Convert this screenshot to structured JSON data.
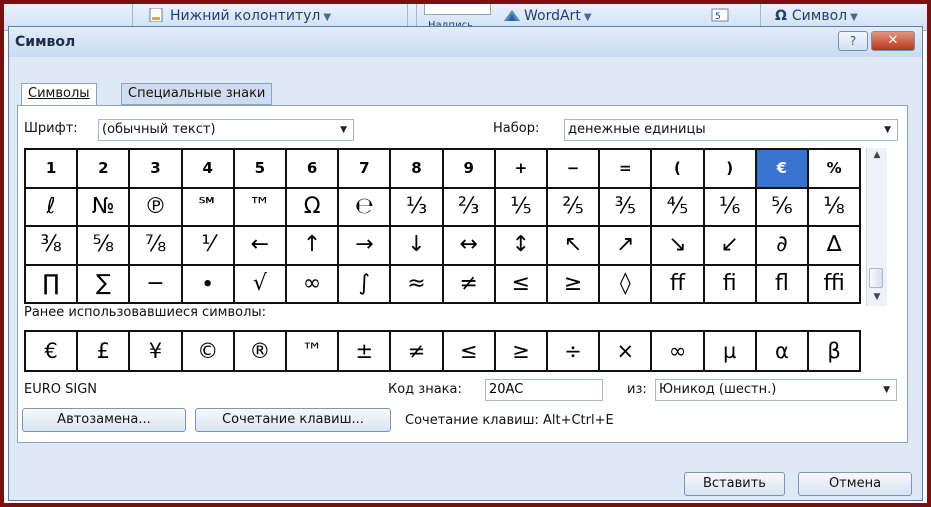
{
  "ribbon": {
    "footer_label": "Нижний колонтитул",
    "wordart_label": "WordArt",
    "symbol_label": "Символ",
    "partial_label": "Надпись",
    "omega_glyph": "Ω"
  },
  "dialog": {
    "title": "Символ",
    "help_glyph": "?",
    "close_glyph": "✕"
  },
  "tabs": [
    {
      "label": "Символы",
      "active": true
    },
    {
      "label": "Специальные знаки",
      "active": false
    }
  ],
  "font": {
    "label": "Шрифт:",
    "value": "(обычный текст)"
  },
  "subset": {
    "label": "Набор:",
    "value": "денежные единицы"
  },
  "symbols": [
    [
      "1",
      "2",
      "3",
      "4",
      "5",
      "6",
      "7",
      "8",
      "9",
      "+",
      "−",
      "=",
      "(",
      ")",
      "€",
      "%"
    ],
    [
      "ℓ",
      "№",
      "℗",
      "℠",
      "™",
      "Ω",
      "℮",
      "⅓",
      "⅔",
      "⅕",
      "⅖",
      "⅗",
      "⅘",
      "⅙",
      "⅚",
      "⅛"
    ],
    [
      "⅜",
      "⅝",
      "⅞",
      "⅟",
      "←",
      "↑",
      "→",
      "↓",
      "↔",
      "↕",
      "↖",
      "↗",
      "↘",
      "↙",
      "∂",
      "∆"
    ],
    [
      "∏",
      "∑",
      "−",
      "∙",
      "√",
      "∞",
      "∫",
      "≈",
      "≠",
      "≤",
      "≥",
      "◊",
      "ff",
      "fi",
      "fl",
      "ffi"
    ]
  ],
  "selected_symbol": "€",
  "recent_label": "Ранее использовавшиеся символы:",
  "recent_symbols": [
    "€",
    "£",
    "¥",
    "©",
    "®",
    "™",
    "±",
    "≠",
    "≤",
    "≥",
    "÷",
    "×",
    "∞",
    "µ",
    "α",
    "β"
  ],
  "char_name": "EURO SIGN",
  "code": {
    "label": "Код знака:",
    "value": "20AC"
  },
  "from": {
    "label": "из:",
    "value": "Юникод (шестн.)"
  },
  "buttons": {
    "autocorrect": "Автозамена...",
    "shortcut_key": "Сочетание клавиш...",
    "insert": "Вставить",
    "cancel": "Отмена"
  },
  "shortcut_text": "Сочетание клавиш: Alt+Ctrl+E",
  "colors": {
    "selection": "#3873d0",
    "frame": "#7a1010"
  },
  "icons": [
    "footer-icon",
    "wordart-icon",
    "number-icon",
    "dropdown-arrow-icon",
    "scroll-up-icon",
    "scroll-down-icon"
  ]
}
